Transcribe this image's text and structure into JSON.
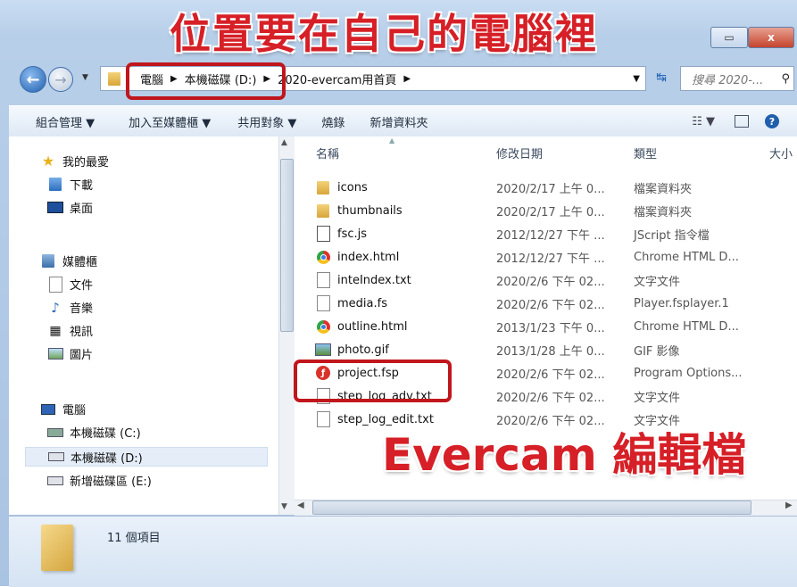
{
  "window": {
    "minimize_glyph": "▭",
    "close_glyph": "x"
  },
  "address": {
    "crumbs": [
      "電腦",
      "本機磁碟 (D:)",
      "2020-evercam用首頁"
    ],
    "search_placeholder": "搜尋 2020-..."
  },
  "toolbar": {
    "organize": "組合管理 ▼",
    "add_to_library": "加入至媒體櫃 ▼",
    "share_with": "共用對象 ▼",
    "burn": "燒錄",
    "new_folder": "新增資料夾"
  },
  "navpane": {
    "favorites": "我的最愛",
    "downloads": "下載",
    "desktop": "桌面",
    "libraries": "媒體櫃",
    "documents": "文件",
    "music": "音樂",
    "videos": "視訊",
    "pictures": "圖片",
    "computer": "電腦",
    "drive_c": "本機磁碟 (C:)",
    "drive_d": "本機磁碟 (D:)",
    "drive_e": "新增磁碟區 (E:)"
  },
  "columns": {
    "name": "名稱",
    "date": "修改日期",
    "type": "類型",
    "size": "大小"
  },
  "files": [
    {
      "name": "icons",
      "date": "2020/2/17 上午 0...",
      "type": "檔案資料夾",
      "icon": "folder-icon"
    },
    {
      "name": "thumbnails",
      "date": "2020/2/17 上午 0...",
      "type": "檔案資料夾",
      "icon": "folder-icon"
    },
    {
      "name": "fsc.js",
      "date": "2012/12/27 下午 ...",
      "type": "JScript 指令檔",
      "icon": "script-icon"
    },
    {
      "name": "index.html",
      "date": "2012/12/27 下午 ...",
      "type": "Chrome HTML D...",
      "icon": "chrome-icon"
    },
    {
      "name": "inteIndex.txt",
      "date": "2020/2/6 下午 02...",
      "type": "文字文件",
      "icon": "text-file-icon"
    },
    {
      "name": "media.fs",
      "date": "2020/2/6 下午 02...",
      "type": "Player.fsplayer.1",
      "icon": "file-icon"
    },
    {
      "name": "outline.html",
      "date": "2013/1/23 下午 0...",
      "type": "Chrome HTML D...",
      "icon": "chrome-icon"
    },
    {
      "name": "photo.gif",
      "date": "2013/1/28 上午 0...",
      "type": "GIF 影像",
      "icon": "image-icon"
    },
    {
      "name": "project.fsp",
      "date": "2020/2/6 下午 02...",
      "type": "Program Options...",
      "icon": "fsp-icon"
    },
    {
      "name": "step_log_adv.txt",
      "date": "2020/2/6 下午 02...",
      "type": "文字文件",
      "icon": "text-file-icon"
    },
    {
      "name": "step_log_edit.txt",
      "date": "2020/2/6 下午 02...",
      "type": "文字文件",
      "icon": "text-file-icon"
    }
  ],
  "status": {
    "item_count": "11 個項目"
  },
  "annotations": {
    "title": "位置要在自己的電腦裡",
    "evercam": "Evercam 編輯檔"
  },
  "colors": {
    "annotation_red": "#d61f26"
  }
}
